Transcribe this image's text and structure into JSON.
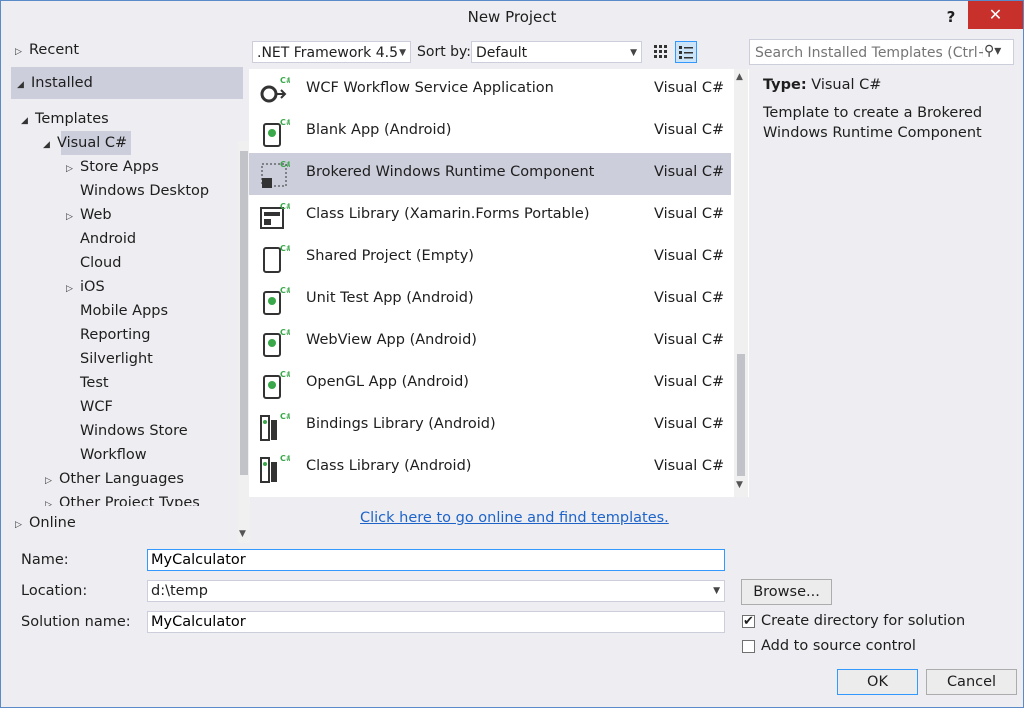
{
  "window": {
    "title": "New Project",
    "help": "?",
    "close": "✕"
  },
  "tree": {
    "recent": "Recent",
    "installed": "Installed",
    "templates": "Templates",
    "visual_csharp": "Visual C#",
    "children": [
      "Store Apps",
      "Windows Desktop",
      "Web",
      "Android",
      "Cloud",
      "iOS",
      "Mobile Apps",
      "Reporting",
      "Silverlight",
      "Test",
      "WCF",
      "Windows Store",
      "Workflow"
    ],
    "other_languages": "Other Languages",
    "other_project_types": "Other Project Types",
    "online": "Online"
  },
  "toolbar": {
    "framework": ".NET Framework 4.5",
    "sort_label": "Sort by:",
    "sort_value": "Default",
    "search_placeholder": "Search Installed Templates (Ctrl+E)"
  },
  "templates": [
    {
      "name": "WCF Workflow Service Application",
      "lang": "Visual C#",
      "icon": "wcf-workflow-icon"
    },
    {
      "name": "Blank App (Android)",
      "lang": "Visual C#",
      "icon": "android-app-icon"
    },
    {
      "name": "Brokered Windows Runtime Component",
      "lang": "Visual C#",
      "icon": "brokered-component-icon"
    },
    {
      "name": "Class Library (Xamarin.Forms Portable)",
      "lang": "Visual C#",
      "icon": "class-library-icon"
    },
    {
      "name": "Shared Project (Empty)",
      "lang": "Visual C#",
      "icon": "shared-project-icon"
    },
    {
      "name": "Unit Test App (Android)",
      "lang": "Visual C#",
      "icon": "android-test-icon"
    },
    {
      "name": "WebView App (Android)",
      "lang": "Visual C#",
      "icon": "android-webview-icon"
    },
    {
      "name": "OpenGL App (Android)",
      "lang": "Visual C#",
      "icon": "android-opengl-icon"
    },
    {
      "name": "Bindings Library (Android)",
      "lang": "Visual C#",
      "icon": "android-bindings-icon"
    },
    {
      "name": "Class Library (Android)",
      "lang": "Visual C#",
      "icon": "android-library-icon"
    }
  ],
  "details": {
    "type_label": "Type:",
    "type_value": "Visual C#",
    "description": "Template to create a Brokered Windows Runtime Component"
  },
  "online_link": "Click here to go online and find templates.",
  "form": {
    "name_label": "Name:",
    "name_value": "MyCalculator",
    "location_label": "Location:",
    "location_value": "d:\\temp",
    "solution_label": "Solution name:",
    "solution_value": "MyCalculator",
    "browse": "Browse...",
    "create_dir": "Create directory for solution",
    "source_control": "Add to source control",
    "ok": "OK",
    "cancel": "Cancel"
  },
  "colors": {
    "selection": "#cccedb",
    "link": "#1e64c8",
    "close": "#c7302b",
    "android": "#39a74a"
  }
}
